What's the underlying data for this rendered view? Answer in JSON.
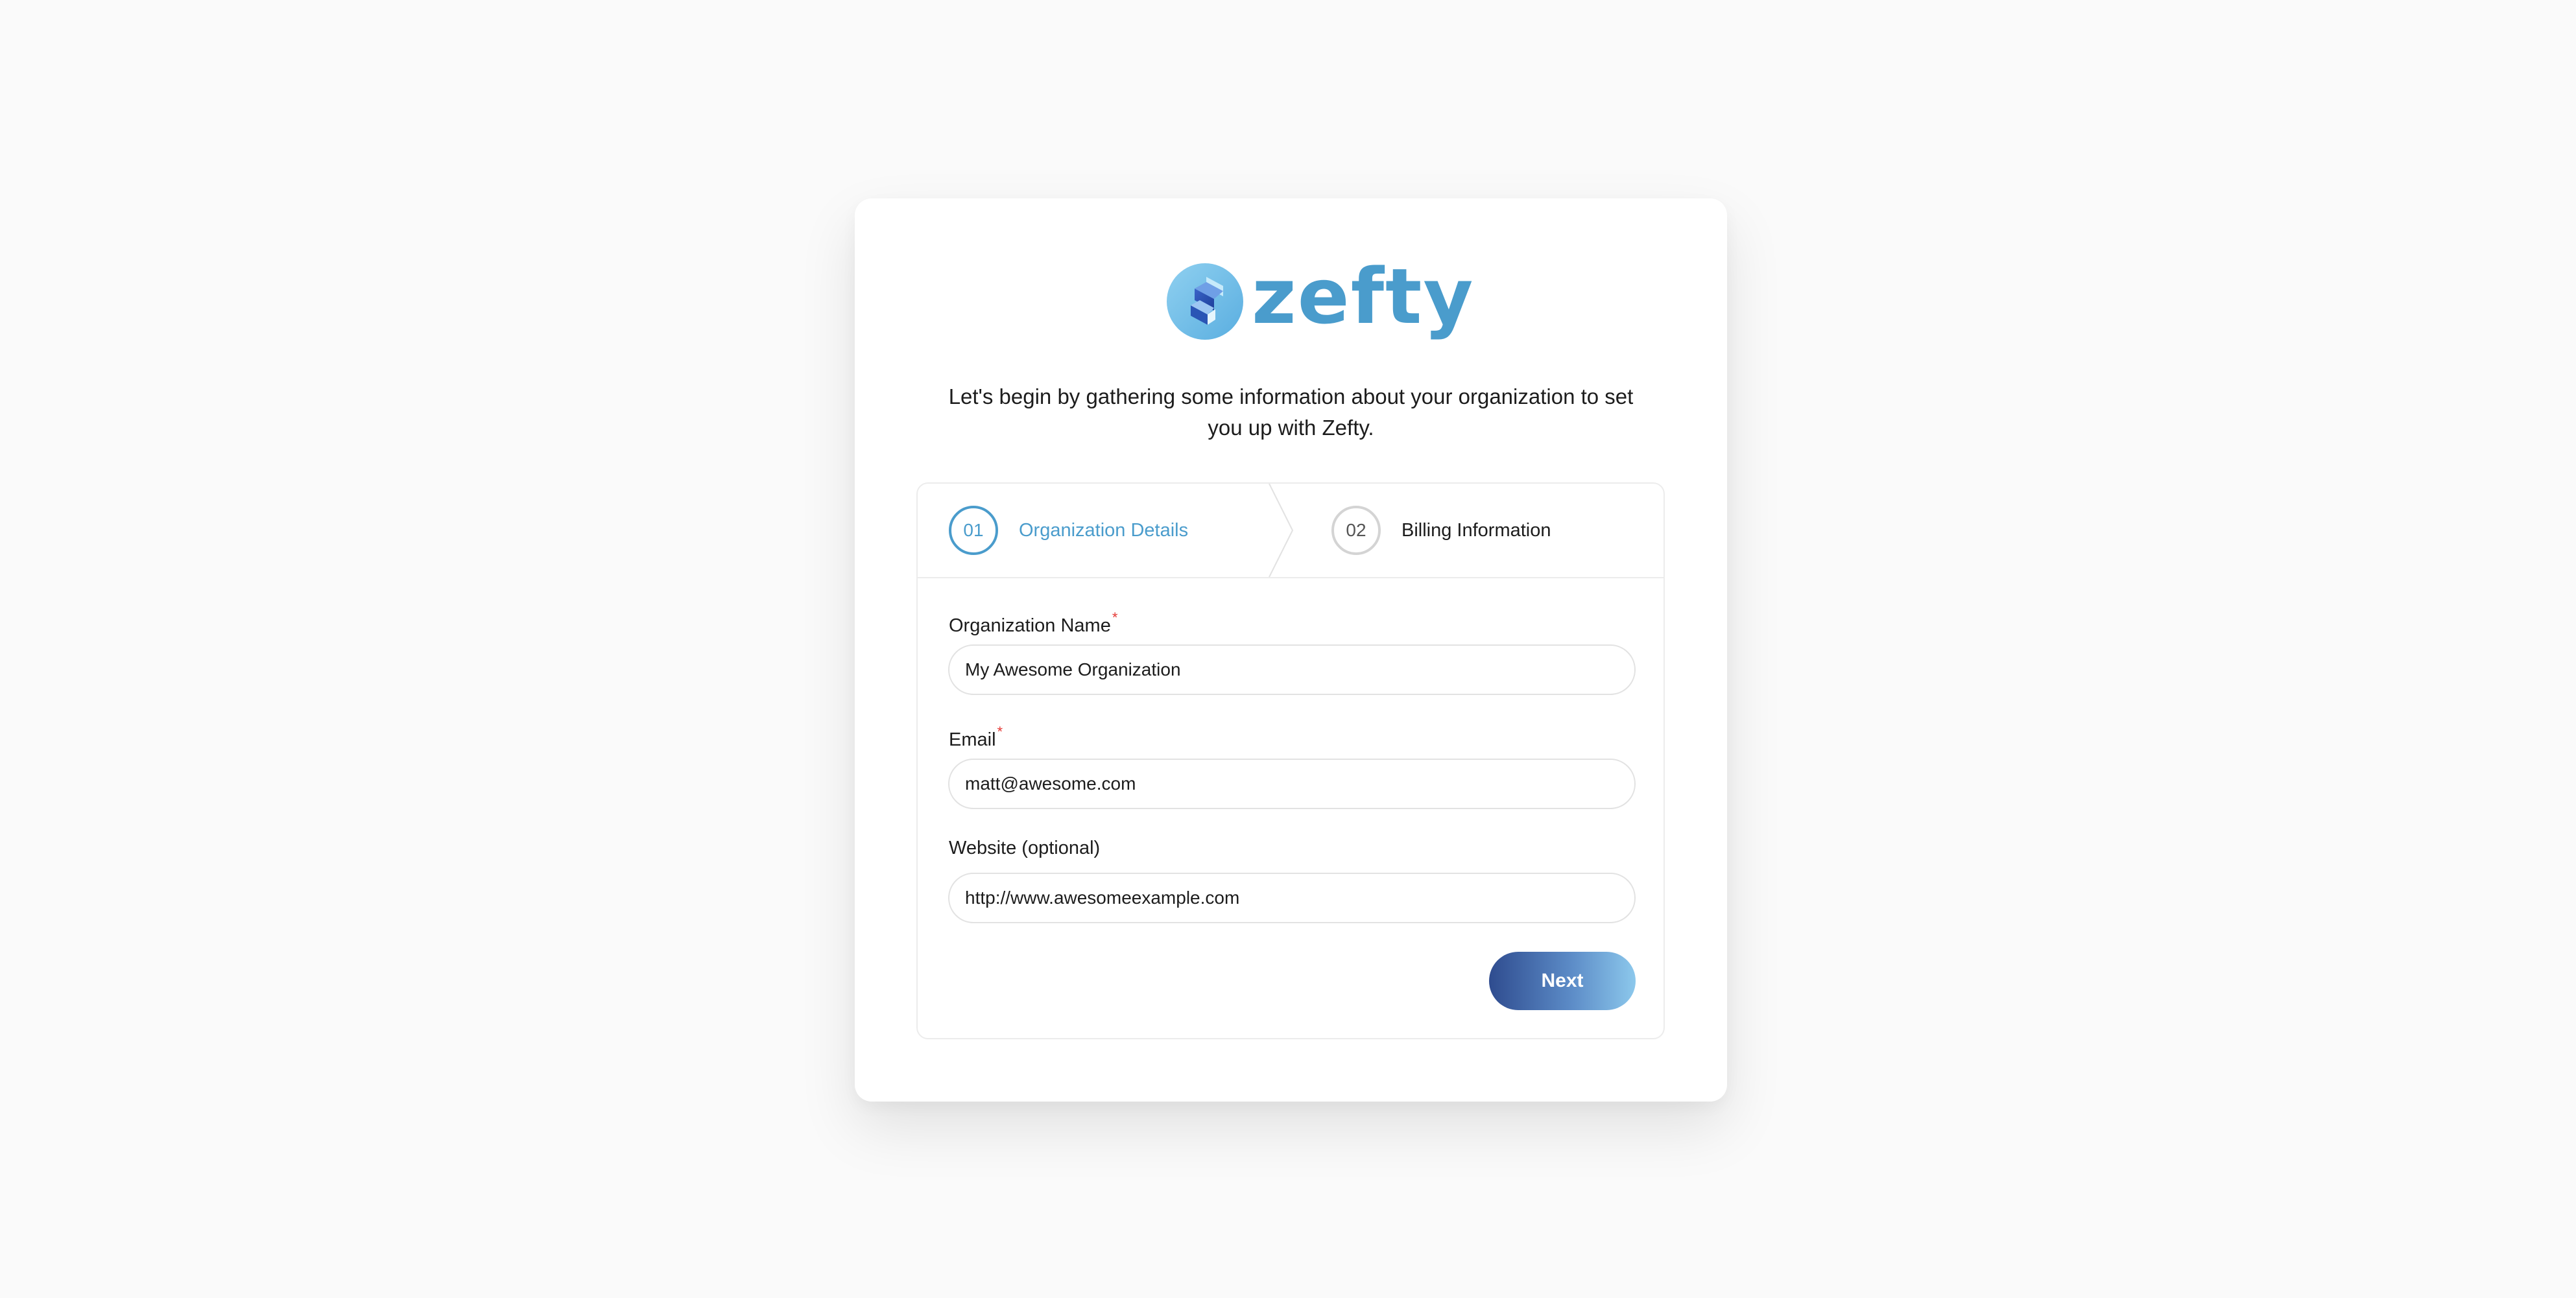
{
  "brand": {
    "name": "zefty",
    "icon": "zefty-logo-icon",
    "color": "#4a9ccc"
  },
  "intro_text": "Let's begin by gathering some information about your organization to set you up with Zefty.",
  "steps": [
    {
      "number": "01",
      "label": "Organization Details",
      "state": "active"
    },
    {
      "number": "02",
      "label": "Billing Information",
      "state": "inactive"
    }
  ],
  "form": {
    "org_name": {
      "label": "Organization Name",
      "required_mark": "*",
      "value": "My Awesome Organization"
    },
    "email": {
      "label": "Email",
      "required_mark": "*",
      "value": "matt@awesome.com"
    },
    "website": {
      "label": "Website (optional)",
      "value": "http://www.awesomeexample.com"
    }
  },
  "actions": {
    "next_label": "Next"
  },
  "colors": {
    "accent": "#4a9ccc",
    "required": "#e53935",
    "button_gradient_start": "#2f4c8f",
    "button_gradient_end": "#8cc8ec"
  }
}
